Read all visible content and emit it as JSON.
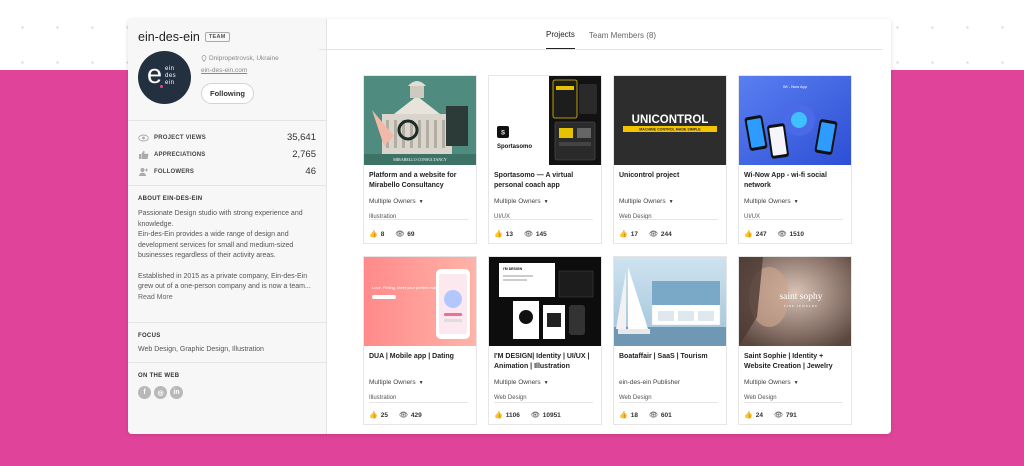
{
  "profile": {
    "name": "ein-des-ein",
    "badge": "TEAM",
    "logo_text": {
      "big": "e",
      "small": [
        "ein",
        "des",
        "ein"
      ]
    },
    "location": "Dnipropetrovsk, Ukraine",
    "website": "ein-des-ein.com",
    "follow_label": "Following"
  },
  "stats": [
    {
      "label": "PROJECT VIEWS",
      "value": "35,641",
      "icon": "eye-icon"
    },
    {
      "label": "APPRECIATIONS",
      "value": "2,765",
      "icon": "thumbs-up-icon"
    },
    {
      "label": "FOLLOWERS",
      "value": "46",
      "icon": "followers-icon"
    }
  ],
  "about": {
    "title": "ABOUT EIN-DES-EIN",
    "p1": "Passionate Design studio with strong experience and knowledge.",
    "p2": "Ein-des-Ein provides a wide range of design and development services for small and medium-sized businesses regardless of their activity areas.",
    "p3": "Established in 2015 as a private company, Ein-des-Ein grew out of a one-person company and is now a team...",
    "read_more": "Read More"
  },
  "focus": {
    "title": "FOCUS",
    "text": "Web Design, Graphic Design, Illustration"
  },
  "web": {
    "title": "ON THE WEB",
    "icons": [
      "facebook-icon",
      "dribbble-icon",
      "linkedin-icon"
    ]
  },
  "tabs": [
    {
      "label": "Projects",
      "active": true
    },
    {
      "label": "Team Members (8)",
      "active": false
    }
  ],
  "projects": [
    {
      "title": "Platform and a website for Mirabello Consultancy",
      "owner": "Multiple Owners",
      "category": "Illustration",
      "likes": "8",
      "views": "69"
    },
    {
      "title": "Sportasomo — A virtual personal coach app",
      "owner": "Multiple Owners",
      "category": "UI/UX",
      "likes": "13",
      "views": "145"
    },
    {
      "title": "Unicontrol project",
      "owner": "Multiple Owners",
      "category": "Web Design",
      "likes": "17",
      "views": "244"
    },
    {
      "title": "Wi-Now App - wi-fi social network",
      "owner": "Multiple Owners",
      "category": "UI/UX",
      "likes": "247",
      "views": "1510"
    },
    {
      "title": "DUA | Mobile app | Dating",
      "owner": "Multiple Owners",
      "category": "Illustration",
      "likes": "25",
      "views": "429"
    },
    {
      "title": "I'M DESIGN| Identity | UI/UX | Animation | Illustration",
      "owner": "Multiple Owners",
      "category": "Web Design",
      "likes": "1106",
      "views": "10951"
    },
    {
      "title": "Boataffair | SaaS | Tourism",
      "owner": "ein-des-ein Publisher",
      "category": "Web Design",
      "likes": "18",
      "views": "601"
    },
    {
      "title": "Saint Sophie | Identity + Website Creation | Jewelry",
      "owner": "Multiple Owners",
      "category": "Web Design",
      "likes": "24",
      "views": "791"
    }
  ],
  "thumb_text": {
    "mirabello": "MIRABELLO CONSULTANCY",
    "sportasomo": "Sportasomo",
    "unicontrol": "UNICONTROL",
    "unicontrol_sub": "MACHINE CONTROL MADE SIMPLE",
    "winow": "Wi - Now App",
    "dua": "Love, Flirting, Meet your perfect match with",
    "saint": "saint sophy",
    "saint_sub": "FINE JEWELRY",
    "imdesign": "I'M DESIGN"
  },
  "colors": {
    "accent_pink": "#e0449a",
    "logo_bg": "#233040",
    "unicontrol_yellow": "#f5c400"
  }
}
